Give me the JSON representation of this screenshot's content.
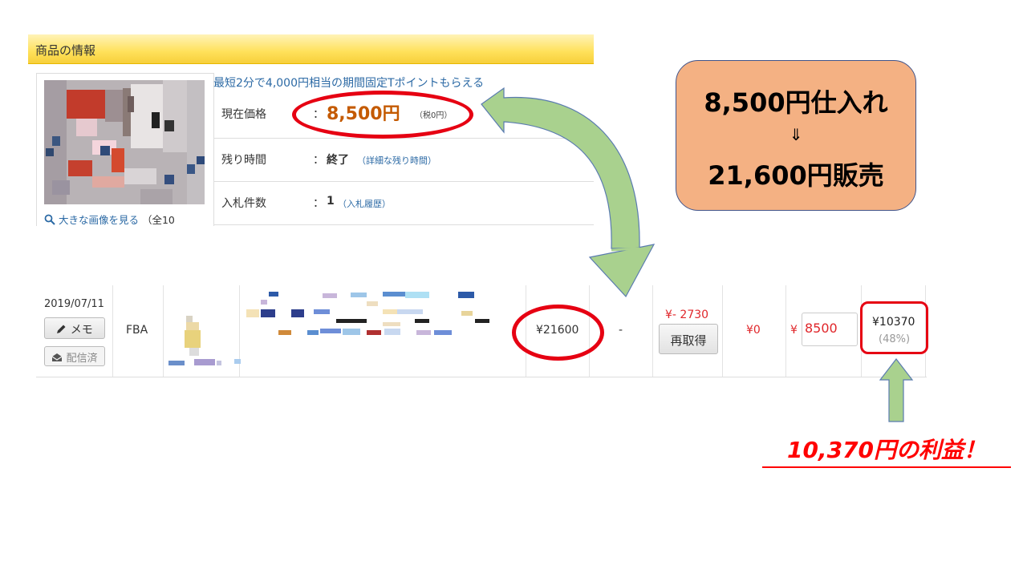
{
  "auction_panel": {
    "header": "商品の情報",
    "promo_link": "最短2分で4,000円相当の期間固定Tポイントもらえる",
    "rows": [
      {
        "label": "現在価格",
        "colon": "：",
        "value": "8,500円",
        "sub": "（税0円）"
      },
      {
        "label": "残り時間",
        "colon": "：",
        "value": "終了",
        "sub": "（詳細な残り時間）"
      },
      {
        "label": "入札件数",
        "colon": "：",
        "value": "1",
        "sub": "（入札履歴）"
      }
    ],
    "zoom_link": "大きな画像を見る",
    "zoom_rest": "（全10"
  },
  "callout": {
    "line1": "8,500円仕入れ",
    "arrow": "⇓",
    "line2": "21,600円販売"
  },
  "sales_row": {
    "date": "2019/07/11",
    "memo_button": "メモ",
    "sent_button": "配信済",
    "channel": "FBA",
    "sale_price": "¥21600",
    "dash": "-",
    "fee": "¥- 2730",
    "refetch_button": "再取得",
    "shipping": "¥0",
    "cost_currency": "¥",
    "cost_value": "8500",
    "profit": "¥10370",
    "profit_percent": "(48%)"
  },
  "result_text": "10,370円の利益！",
  "colors": {
    "highlight": "#e60012",
    "callout_bg": "#f4b183",
    "arrow_green": "#a9d18e",
    "price_orange": "#c45a00"
  },
  "icons": [
    "search-icon",
    "pencil-icon",
    "envelope-icon",
    "curved-arrow-icon",
    "up-arrow-icon"
  ]
}
